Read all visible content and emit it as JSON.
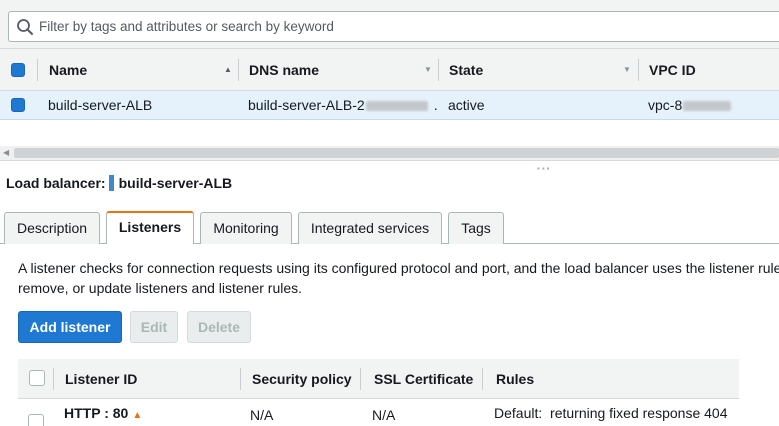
{
  "filter": {
    "placeholder": "Filter by tags and attributes or search by keyword"
  },
  "lb_table": {
    "columns": [
      "Name",
      "DNS name",
      "State",
      "VPC ID"
    ],
    "rows": [
      {
        "name": "build-server-ALB",
        "dns_name": "build-server-ALB-2",
        "dns_suffix": ".",
        "state": "active",
        "vpc_id": "vpc-8",
        "selected": true
      }
    ]
  },
  "detail": {
    "title_label": "Load balancer:",
    "title_value": "build-server-ALB",
    "tabs": [
      "Description",
      "Listeners",
      "Monitoring",
      "Integrated services",
      "Tags"
    ],
    "active_tab": "Listeners",
    "description_line1": "A listener checks for connection requests using its configured protocol and port, and the load balancer uses the listener rule",
    "description_line2": "remove, or update listeners and listener rules.",
    "buttons": {
      "add": "Add listener",
      "edit": "Edit",
      "delete": "Delete"
    }
  },
  "listener_table": {
    "columns": [
      "Listener ID",
      "Security policy",
      "SSL Certificate",
      "Rules"
    ],
    "rows": [
      {
        "listener_id": "HTTP : 80",
        "security_policy": "N/A",
        "ssl_certificate": "N/A",
        "rules": "Default:  returning fixed response 404"
      }
    ]
  },
  "icons": {
    "search": "search-icon",
    "warning": "warning-icon",
    "sort_asc": "sort-ascending-icon",
    "sort_desc": "sort-descending-icon"
  },
  "colors": {
    "primary": "#1f78d1",
    "active_tab_accent": "#ec7211",
    "selected_row": "#e6f2fb",
    "header_bg": "#f2f3f3"
  }
}
